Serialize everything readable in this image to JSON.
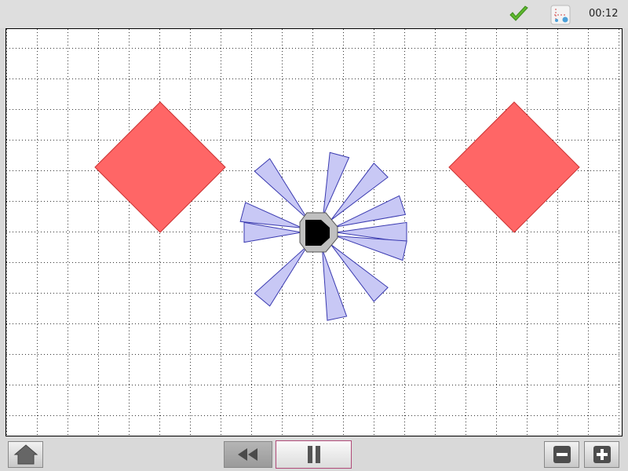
{
  "topbar": {
    "status_icon": "checkmark-icon",
    "status_color": "#5fb82e",
    "sim_icon": "simulation-settings-icon",
    "timer": "00:12"
  },
  "stage": {
    "grid": true,
    "background": "#ffffff",
    "obstacle_color": "#ff6666",
    "sensor_beam_color": "#c8c8f5",
    "robot_body_color": "#000000",
    "robot_shell_color": "#c0c0c0",
    "obstacles": [
      "obstacle-left",
      "obstacle-right"
    ],
    "sensor_count": 11
  },
  "controls": {
    "home_icon": "home-icon",
    "rewind_icon": "rewind-icon",
    "pause_icon": "pause-icon",
    "zoom_out_icon": "zoom-out-icon",
    "zoom_in_icon": "zoom-in-icon"
  }
}
